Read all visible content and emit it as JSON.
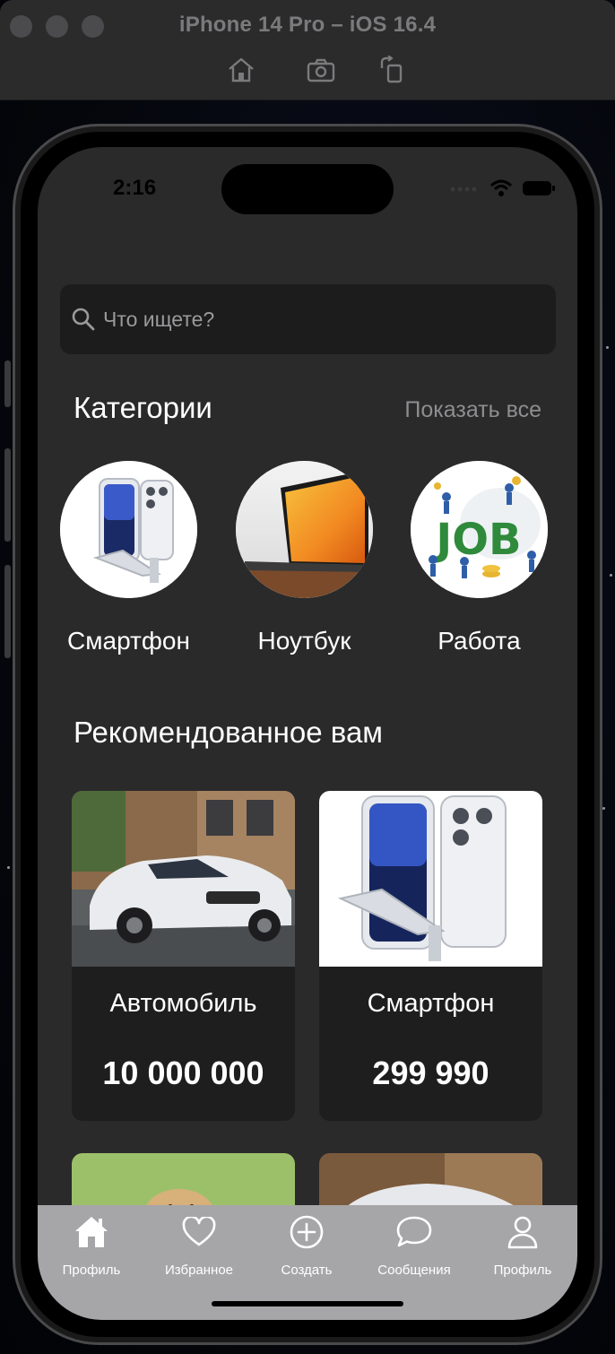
{
  "simulator": {
    "title": "iPhone 14 Pro – iOS 16.4",
    "tools": [
      "home-icon",
      "screenshot-icon",
      "rotate-icon"
    ]
  },
  "status": {
    "time": "2:16"
  },
  "search": {
    "placeholder": "Что ищете?"
  },
  "categories": {
    "title": "Категории",
    "show_all": "Показать все",
    "items": [
      {
        "label": "Смартфон"
      },
      {
        "label": "Ноутбук"
      },
      {
        "label": "Работа"
      }
    ]
  },
  "recommended": {
    "title": "Рекомендованное вам",
    "items": [
      {
        "name": "Автомобиль",
        "price": "10 000 000"
      },
      {
        "name": "Смартфон",
        "price": "299 990"
      }
    ]
  },
  "tabbar": {
    "items": [
      {
        "label": "Профиль",
        "icon": "house-icon"
      },
      {
        "label": "Избранное",
        "icon": "heart-icon"
      },
      {
        "label": "Создать",
        "icon": "plus-circle-icon"
      },
      {
        "label": "Сообщения",
        "icon": "chat-bubble-icon"
      },
      {
        "label": "Профиль",
        "icon": "person-icon"
      }
    ]
  }
}
